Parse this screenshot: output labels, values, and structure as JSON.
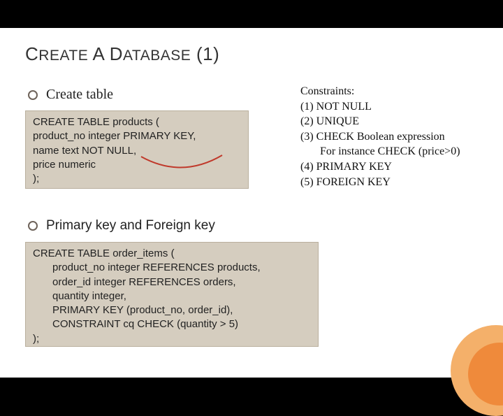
{
  "title": {
    "word1_initial": "C",
    "word1_rest": "REATE",
    "word2_initial": "A",
    "word3_initial": "D",
    "word3_rest": "ATABASE",
    "suffix": "(1)"
  },
  "bullets": {
    "b1": "Create table",
    "b2": "Primary key and Foreign key"
  },
  "code1": {
    "l1": "CREATE TABLE products (",
    "l2": "product_no integer PRIMARY KEY,",
    "l3": "name text NOT NULL,",
    "l4": "price numeric",
    "l5": ");"
  },
  "code2": {
    "l1": "CREATE TABLE order_items (",
    "l2": "product_no integer REFERENCES products,",
    "l3": "order_id integer REFERENCES orders,",
    "l4": "quantity integer,",
    "l5": "PRIMARY KEY (product_no, order_id),",
    "l6": "CONSTRAINT cq CHECK (quantity > 5)",
    "l7": ");"
  },
  "constraints": {
    "heading": "Constraints:",
    "i1": "(1) NOT NULL",
    "i2": "(2) UNIQUE",
    "i3": "(3) CHECK Boolean expression",
    "i3b": "For instance CHECK (price>0)",
    "i4": "(4) PRIMARY KEY",
    "i5": "(5) FOREIGN KEY"
  }
}
